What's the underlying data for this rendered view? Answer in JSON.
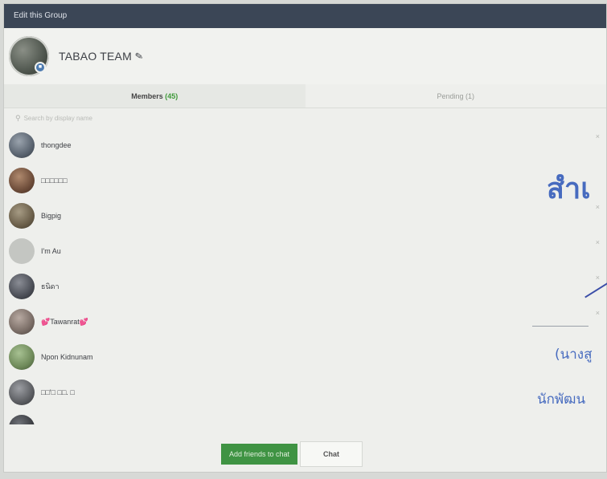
{
  "window": {
    "title": "Edit this Group"
  },
  "group": {
    "name": "TABAO TEAM"
  },
  "tabs": [
    {
      "label": "Members",
      "count": "(45)"
    },
    {
      "label": "Pending (1)"
    }
  ],
  "search": {
    "placeholder": "Search by display name"
  },
  "members": [
    {
      "name": "thongdee",
      "avatar_color": "#5a6470"
    },
    {
      "name": "□□□□□□",
      "avatar_color": "#6e4d3a"
    },
    {
      "name": "Bigpig",
      "avatar_color": "#6b5f4a"
    },
    {
      "name": "I'm Au",
      "avatar_color": "#c4c6c2"
    },
    {
      "name": "ธนิดา",
      "avatar_color": "#4c4f57"
    },
    {
      "name": "💕Tawanrat💕",
      "avatar_color": "#7a6d66"
    },
    {
      "name": "Npon Kidnunam",
      "avatar_color": "#6f8a5a"
    },
    {
      "name": "□□'□ □□. □",
      "avatar_color": "#5c5e62"
    },
    {
      "name": "",
      "avatar_color": "#3b3d42"
    }
  ],
  "remove_icon": "×",
  "overlay": {
    "heading": "สำเ",
    "line1": "(นางสู",
    "line2": "นักพัฒน"
  },
  "footer": {
    "add_label": "Add friends to chat",
    "chat_label": "Chat"
  },
  "colors": {
    "titlebar": "#3b4656",
    "accent_green": "#3f9343",
    "ink_blue": "#2b55b8"
  }
}
